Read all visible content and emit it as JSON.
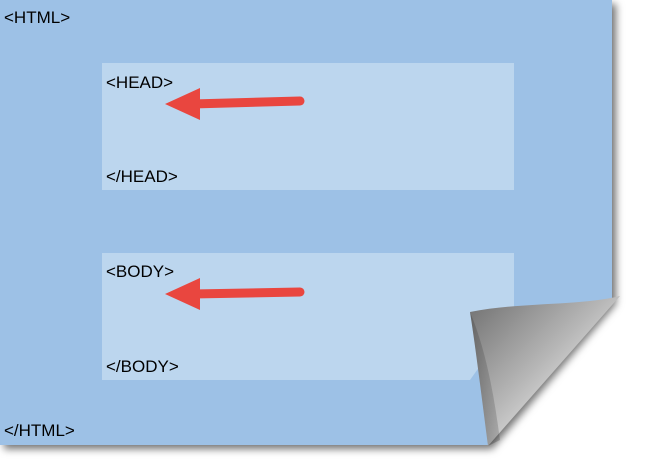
{
  "colors": {
    "page": "#9dc1e6",
    "section": "#bcd6ee",
    "arrow": "#e9463f",
    "text": "#000000",
    "curl_light": "#f2f2f2",
    "curl_dark": "#8c8c8c"
  },
  "html_block": {
    "open_tag": "<HTML>",
    "close_tag": "</HTML>"
  },
  "head_block": {
    "open_tag": "<HEAD>",
    "close_tag": "</HEAD>",
    "arrow_icon": "left-arrow-icon"
  },
  "body_block": {
    "open_tag": "<BODY>",
    "close_tag": "</BODY>",
    "arrow_icon": "left-arrow-icon"
  },
  "page_curl_icon": "page-curl-icon"
}
